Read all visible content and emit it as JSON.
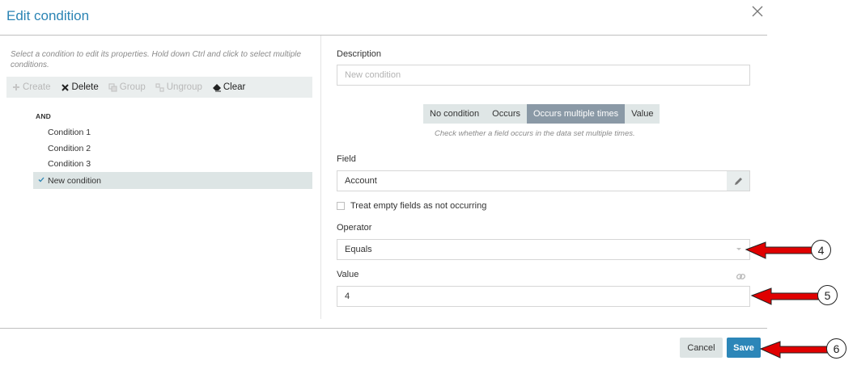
{
  "dialog": {
    "title": "Edit condition",
    "close_icon": "close-icon"
  },
  "left": {
    "hint": "Select a condition to edit its properties. Hold down Ctrl and click to select multiple conditions.",
    "toolbar": {
      "create": "Create",
      "delete": "Delete",
      "group": "Group",
      "ungroup": "Ungroup",
      "clear": "Clear"
    },
    "tree": {
      "root": "AND",
      "items": [
        "Condition 1",
        "Condition 2",
        "Condition 3"
      ],
      "selected": "New condition"
    }
  },
  "right": {
    "description_label": "Description",
    "description_placeholder": "New condition",
    "condition_types": [
      "No condition",
      "Occurs",
      "Occurs multiple times",
      "Value"
    ],
    "active_type": "Occurs multiple times",
    "type_hint": "Check whether a field occurs in the data set multiple times.",
    "field_label": "Field",
    "field_value": "Account",
    "treat_empty_label": "Treat empty fields as not occurring",
    "treat_empty_checked": false,
    "operator_label": "Operator",
    "operator_value": "Equals",
    "value_label": "Value",
    "value_value": "4"
  },
  "footer": {
    "cancel": "Cancel",
    "save": "Save"
  },
  "annotations": [
    "4",
    "5",
    "6"
  ],
  "colors": {
    "accent": "#2b84b4",
    "arrow": "#e00000",
    "active_segment": "#8a99a6"
  }
}
